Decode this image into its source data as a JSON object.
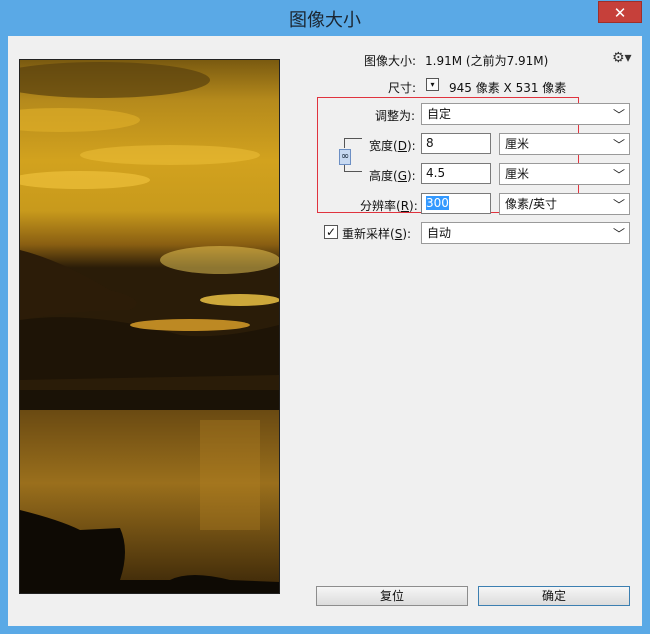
{
  "window": {
    "title": "图像大小",
    "close_label": "✕"
  },
  "info": {
    "size_label": "图像大小:",
    "size_value": "1.91M (之前为7.91M)",
    "dim_label": "尺寸:",
    "dim_value": "945 像素  X  531 像素",
    "gear_icon": "gear-icon"
  },
  "form": {
    "fit_label": "调整为:",
    "fit_value": "自定",
    "width_label_pre": "宽度(",
    "width_key": "D",
    "width_label_post": "):",
    "width_value": "8",
    "width_unit": "厘米",
    "height_label_pre": "高度(",
    "height_key": "G",
    "height_label_post": "):",
    "height_value": "4.5",
    "height_unit": "厘米",
    "res_label_pre": "分辨率(",
    "res_key": "R",
    "res_label_post": "):",
    "res_value": "300",
    "res_unit": "像素/英寸",
    "resample_label_pre": "重新采样(",
    "resample_key": "S",
    "resample_label_post": "):",
    "resample_checked": true,
    "resample_value": "自动"
  },
  "buttons": {
    "reset": "复位",
    "ok": "确定"
  },
  "colors": {
    "title_bar": "#5aa9e6",
    "highlight_box": "#e0333e",
    "selection": "#3399ff"
  }
}
